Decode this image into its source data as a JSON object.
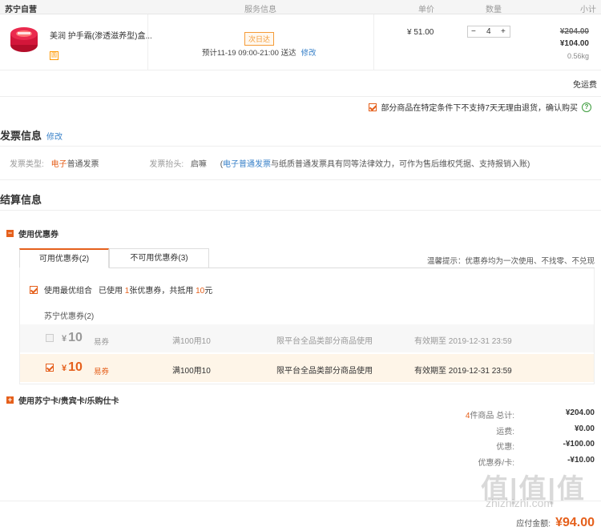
{
  "header": {
    "store": "苏宁自营",
    "col_service": "服务信息",
    "col_price": "单价",
    "col_qty": "数量",
    "col_subtotal": "小计"
  },
  "product": {
    "name": "美润 护手霜(渗透滋养型)盒...",
    "tag": "圆",
    "ship_badge": "次日达",
    "ship_time": "预计11-19 09:00-21:00  送达",
    "ship_edit": "修改",
    "price": "¥ 51.00",
    "qty_minus": "−",
    "qty": "4",
    "qty_plus": "+",
    "orig_total": "¥204.00",
    "subtotal": "¥104.00",
    "weight": "0.56kg"
  },
  "free_shipping": "免运费",
  "agree_text": "部分商品在特定条件下不支持7天无理由退货，确认购买",
  "invoice": {
    "title": "发票信息",
    "edit": "修改",
    "type_label": "发票类型:",
    "type_red": "电子",
    "type_rest": "普通发票",
    "head_label": "发票抬头:",
    "head_value": "启嘛",
    "note_open": "(",
    "note_link": "电子普通发票",
    "note_rest": "与纸质普通发票具有同等法律效力，可作为售后维权凭据、支持报销入账)"
  },
  "settle": {
    "title": "结算信息",
    "coupon_section": "使用优惠券",
    "tab_available": "可用优惠券(2)",
    "tab_unavailable": "不可用优惠券(3)",
    "tip": "温馨提示：优惠券均为一次使用、不找零、不兑现",
    "best_label": "使用最优组合",
    "best_used_pre": "已使用",
    "best_used_num": "1",
    "best_used_mid": "张优惠券，共抵用",
    "best_used_amt": "10",
    "best_used_post": "元",
    "group": "苏宁优惠券(2)",
    "coupons": [
      {
        "currency": "¥",
        "amount": "10",
        "unit": "易券",
        "cond": "满100用10",
        "scope": "限平台全品类部分商品使用",
        "expiry": "有效期至 2019-12-31 23:59"
      },
      {
        "currency": "¥",
        "amount": "10",
        "unit": "易券",
        "cond": "满100用10",
        "scope": "限平台全品类部分商品使用",
        "expiry": "有效期至 2019-12-31 23:59"
      }
    ],
    "card_section": "使用苏宁卡/贵宾卡/乐购仕卡"
  },
  "summary": {
    "count_num": "4",
    "count_label": "件商品 总计:",
    "total": "¥204.00",
    "shipping_label": "运费:",
    "shipping": "¥0.00",
    "discount_label": "优惠:",
    "discount": "-¥100.00",
    "coupon_label": "优惠券/卡:",
    "coupon": "-¥10.00",
    "payable_label": "应付金额:",
    "payable": "¥94.00"
  },
  "watermark": "值|值|值",
  "watermark_url": "zhizhizhi.com",
  "colors": {
    "accent": "#e5601c",
    "link": "#3a82c9"
  }
}
